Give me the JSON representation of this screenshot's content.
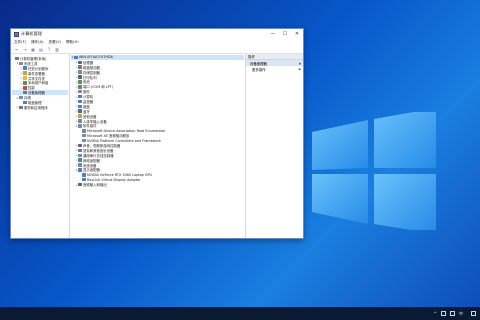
{
  "window": {
    "title": "计算机管理",
    "controls": {
      "minimize": "—",
      "maximize": "☐",
      "close": "✕"
    }
  },
  "menu": [
    "文件(F)",
    "操作(A)",
    "查看(V)",
    "帮助(H)"
  ],
  "toolbar": [
    "←",
    "→",
    "▦",
    "▤",
    "?",
    "▥"
  ],
  "left_tree": [
    {
      "label": "计算机管理(本地)",
      "level": 0,
      "exp": "",
      "icon_color": "#6d7a8a"
    },
    {
      "label": "系统工具",
      "level": 1,
      "exp": "∨",
      "icon_color": "#7a8a9e"
    },
    {
      "label": "任务计划程序",
      "level": 2,
      "exp": ">",
      "icon_color": "#4f7fbf"
    },
    {
      "label": "事件查看器",
      "level": 2,
      "exp": ">",
      "icon_color": "#c9a23a"
    },
    {
      "label": "共享文件夹",
      "level": 2,
      "exp": ">",
      "icon_color": "#e0b84a"
    },
    {
      "label": "本地用户和组",
      "level": 2,
      "exp": ">",
      "icon_color": "#5a8f5a"
    },
    {
      "label": "性能",
      "level": 2,
      "exp": ">",
      "icon_color": "#c0504d"
    },
    {
      "label": "设备管理器",
      "level": 2,
      "exp": "",
      "icon_color": "#6d7a8a",
      "selected": true
    },
    {
      "label": "存储",
      "level": 1,
      "exp": "∨",
      "icon_color": "#7a8a9e"
    },
    {
      "label": "磁盘管理",
      "level": 2,
      "exp": "",
      "icon_color": "#4f7fbf"
    },
    {
      "label": "服务和应用程序",
      "level": 1,
      "exp": ">",
      "icon_color": "#6d7a8a"
    }
  ],
  "device_tree": [
    {
      "label": "WIN-0FUAO7U7HD8",
      "level": 0,
      "exp": "∨",
      "icon_color": "#4f7fbf",
      "highlighted": true
    },
    {
      "label": "处理器",
      "level": 1,
      "exp": ">",
      "icon_color": "#5a6a7a"
    },
    {
      "label": "磁盘驱动器",
      "level": 1,
      "exp": ">",
      "icon_color": "#7a7a7a"
    },
    {
      "label": "存储控制器",
      "level": 1,
      "exp": ">",
      "icon_color": "#7a8a9e"
    },
    {
      "label": "打印队列",
      "level": 1,
      "exp": ">",
      "icon_color": "#5a6a7a"
    },
    {
      "label": "电池",
      "level": 1,
      "exp": ">",
      "icon_color": "#5a8f5a"
    },
    {
      "label": "端口 (COM 和 LPT)",
      "level": 1,
      "exp": ">",
      "icon_color": "#7a7a7a"
    },
    {
      "label": "固件",
      "level": 1,
      "exp": ">",
      "icon_color": "#7a8a9e"
    },
    {
      "label": "计算机",
      "level": 1,
      "exp": ">",
      "icon_color": "#4f7fbf"
    },
    {
      "label": "监视器",
      "level": 1,
      "exp": ">",
      "icon_color": "#4f7fbf"
    },
    {
      "label": "键盘",
      "level": 1,
      "exp": ">",
      "icon_color": "#7a7a7a"
    },
    {
      "label": "蓝牙",
      "level": 1,
      "exp": ">",
      "icon_color": "#2f6fd6"
    },
    {
      "label": "其他设备",
      "level": 1,
      "exp": ">",
      "icon_color": "#c9a23a"
    },
    {
      "label": "人体学输入设备",
      "level": 1,
      "exp": ">",
      "icon_color": "#7a8a9e"
    },
    {
      "label": "软件组件",
      "level": 1,
      "exp": "∨",
      "icon_color": "#7a8a9e"
    },
    {
      "label": "Microsoft Device Association Root Enumerator",
      "level": 2,
      "exp": "",
      "icon_color": "#7a8a9e"
    },
    {
      "label": "Microsoft XE 音频驱动程序",
      "level": 2,
      "exp": "",
      "icon_color": "#7a8a9e"
    },
    {
      "label": "NVIDIA Platform Controllers and Framework",
      "level": 2,
      "exp": "",
      "icon_color": "#7a8a9e"
    },
    {
      "label": "声音、视频和游戏控制器",
      "level": 1,
      "exp": ">",
      "icon_color": "#5a6a7a"
    },
    {
      "label": "鼠标和其他指针设备",
      "level": 1,
      "exp": ">",
      "icon_color": "#7a7a7a"
    },
    {
      "label": "通用串行总线控制器",
      "level": 1,
      "exp": ">",
      "icon_color": "#7a8a9e"
    },
    {
      "label": "网络适配器",
      "level": 1,
      "exp": ">",
      "icon_color": "#4f7fbf"
    },
    {
      "label": "系统设备",
      "level": 1,
      "exp": ">",
      "icon_color": "#7a8a9e"
    },
    {
      "label": "显示适配器",
      "level": 1,
      "exp": "∨",
      "icon_color": "#4f7fbf"
    },
    {
      "label": "NVIDIA GeForce RTX 3060 Laptop GPU",
      "level": 2,
      "exp": "",
      "icon_color": "#4f7fbf"
    },
    {
      "label": "RayLink Virtual Display Adapter",
      "level": 2,
      "exp": "",
      "icon_color": "#4f7fbf"
    },
    {
      "label": "音频输入和输出",
      "level": 1,
      "exp": ">",
      "icon_color": "#5a6a7a"
    }
  ],
  "actions": {
    "header": "操作",
    "items": [
      {
        "label": "设备管理器",
        "caret": "▲",
        "sub": false,
        "highlight": true
      },
      {
        "label": "更多操作",
        "caret": "▶",
        "sub": true,
        "highlight": false
      }
    ]
  },
  "taskbar": {
    "tray": [
      "^",
      "中"
    ],
    "time": "",
    "date": ""
  }
}
